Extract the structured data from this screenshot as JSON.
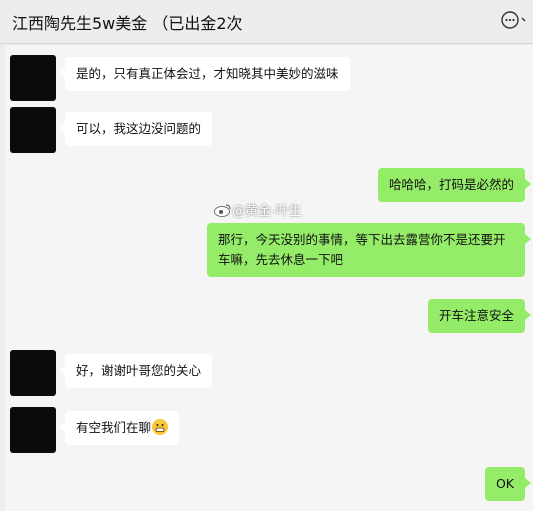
{
  "header": {
    "title": "江西陶先生5w美金 （已出金2次",
    "more_icon": "chat-bubble-more-icon"
  },
  "messages": [
    {
      "side": "left",
      "text": "是的，只有真正体会过，才知晓其中美妙的滋味"
    },
    {
      "side": "left",
      "text": "可以，我这边没问题的"
    },
    {
      "side": "right",
      "text": "哈哈哈，打码是必然的"
    },
    {
      "side": "right",
      "text": "那行，今天没别的事情，等下出去露营你不是还要开车嘛，先去休息一下吧"
    },
    {
      "side": "right",
      "text": "开车注意安全"
    },
    {
      "side": "left",
      "text": "好，谢谢叶哥您的关心"
    },
    {
      "side": "left",
      "text": "有空我们在聊",
      "emoji": "grinning-face-emoji"
    },
    {
      "side": "right",
      "text": "OK"
    }
  ],
  "watermark": {
    "text": "@黄金-叶生",
    "icon": "weibo-logo-icon"
  },
  "colors": {
    "background": "#f5f5f5",
    "header_bg": "#ededed",
    "sent_bubble": "#95ec69",
    "received_bubble": "#ffffff"
  }
}
